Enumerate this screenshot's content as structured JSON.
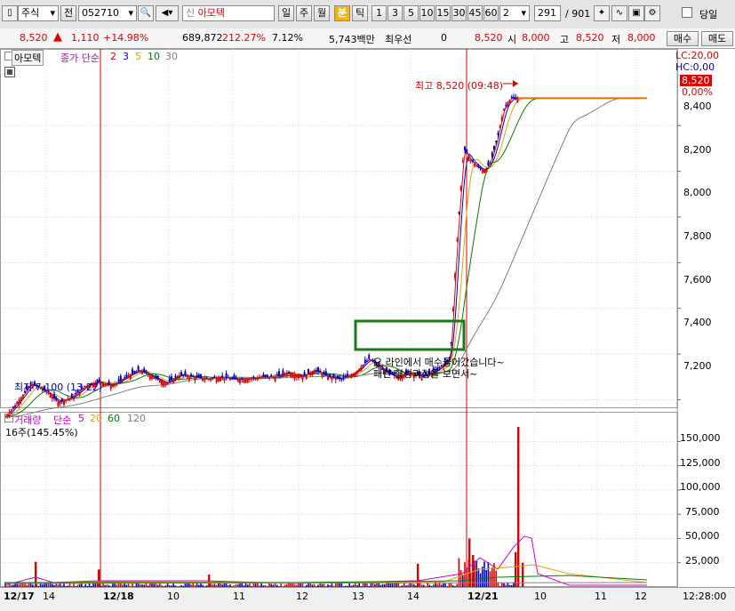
{
  "toolbar": {
    "market_type": "주식",
    "market_mode": "전",
    "stock_code": "052710",
    "new_badge": "신",
    "stock_name": "아모텍",
    "period_day": "일",
    "period_week": "주",
    "period_month": "월",
    "period_minute": "분",
    "period_tick": "틱",
    "intervals": [
      "1",
      "3",
      "5",
      "10",
      "15",
      "30",
      "45",
      "60"
    ],
    "interval_value": "2",
    "count_value": "291",
    "count_total": "/ 901",
    "today_label": "당일"
  },
  "quote": {
    "price": "8,520",
    "change": "1,110",
    "change_pct": "+14.98%",
    "volume": "689,872",
    "volume_ratio": "212.27%",
    "turnover_pct": "7.12%",
    "amount": "5,743백만",
    "pref_label": "최우선",
    "pref_value": "0",
    "last": "8,520",
    "open_label": "시",
    "open": "8,000",
    "high_label": "고",
    "high": "8,520",
    "low_label": "저",
    "low": "8,000",
    "buy_button": "매수",
    "sell_button": "매도"
  },
  "price_panel": {
    "stock_tag": "아모텍",
    "ma_legend_label": "종가 단순",
    "ma_periods": [
      "2",
      "3",
      "5",
      "10",
      "30"
    ],
    "ma_colors": [
      "#e00000",
      "#0000cc",
      "#e8a000",
      "#008000",
      "#808080"
    ],
    "lc_label": "LC:20,00",
    "hc_label": "HC:0,00",
    "current_price_tag": "8,520",
    "current_change_tag": "0,00%",
    "high_annotation": "최고 8,520 (09:48)",
    "low_annotation": "최저 7,100 (13:22)",
    "note_line1": "요 라인에서 매수들어갔습니다~",
    "note_line2": "패턴 형성과정을 보면서~",
    "y_ticks": [
      "8,400",
      "8,200",
      "8,000",
      "7,800",
      "7,600",
      "7,400",
      "7,200"
    ]
  },
  "volume_panel": {
    "legend_label": "거래량",
    "legend_type": "단순",
    "ma_periods": [
      "5",
      "20",
      "60",
      "120"
    ],
    "ma_colors": [
      "#cc00cc",
      "#e8a000",
      "#008000",
      "#808080"
    ],
    "unit_text": "16주(145.45%)",
    "y_ticks": [
      "150,000",
      "125,000",
      "100,000",
      "75,000",
      "50,000",
      "25,000"
    ]
  },
  "time_axis": {
    "labels": [
      "12/17",
      "14",
      "12/18",
      "10",
      "11",
      "12",
      "13",
      "14",
      "12/21",
      "10",
      "11",
      "12"
    ],
    "clock": "12:28:00"
  },
  "colors": {
    "up": "#e00000",
    "down": "#0000cc",
    "highlight_box": "#1a7a1a",
    "session_line": "#e00000"
  },
  "chart_data": {
    "type": "candlestick",
    "interval": "2분",
    "price_range": [
      7050,
      8580
    ],
    "high": 8520,
    "low": 7100,
    "close_path": [
      [
        0,
        7120
      ],
      [
        10,
        7190
      ],
      [
        20,
        7270
      ],
      [
        30,
        7240
      ],
      [
        40,
        7190
      ],
      [
        50,
        7210
      ],
      [
        60,
        7260
      ],
      [
        70,
        7280
      ],
      [
        80,
        7260
      ],
      [
        90,
        7300
      ],
      [
        100,
        7330
      ],
      [
        110,
        7300
      ],
      [
        120,
        7270
      ],
      [
        130,
        7310
      ],
      [
        140,
        7300
      ],
      [
        150,
        7290
      ],
      [
        160,
        7300
      ],
      [
        170,
        7290
      ],
      [
        180,
        7290
      ],
      [
        190,
        7300
      ],
      [
        200,
        7300
      ],
      [
        210,
        7320
      ],
      [
        220,
        7300
      ],
      [
        230,
        7330
      ],
      [
        240,
        7300
      ],
      [
        250,
        7290
      ],
      [
        260,
        7320
      ],
      [
        270,
        7380
      ],
      [
        280,
        7330
      ],
      [
        290,
        7300
      ],
      [
        300,
        7320
      ],
      [
        310,
        7300
      ],
      [
        320,
        7330
      ],
      [
        330,
        7380
      ],
      [
        335,
        7900
      ],
      [
        340,
        8300
      ],
      [
        345,
        8250
      ],
      [
        350,
        8220
      ],
      [
        355,
        8200
      ],
      [
        360,
        8240
      ],
      [
        365,
        8350
      ],
      [
        370,
        8480
      ],
      [
        375,
        8520
      ],
      [
        380,
        8520
      ]
    ],
    "volume_peak": 165000,
    "volume_range": [
      0,
      165000
    ]
  }
}
